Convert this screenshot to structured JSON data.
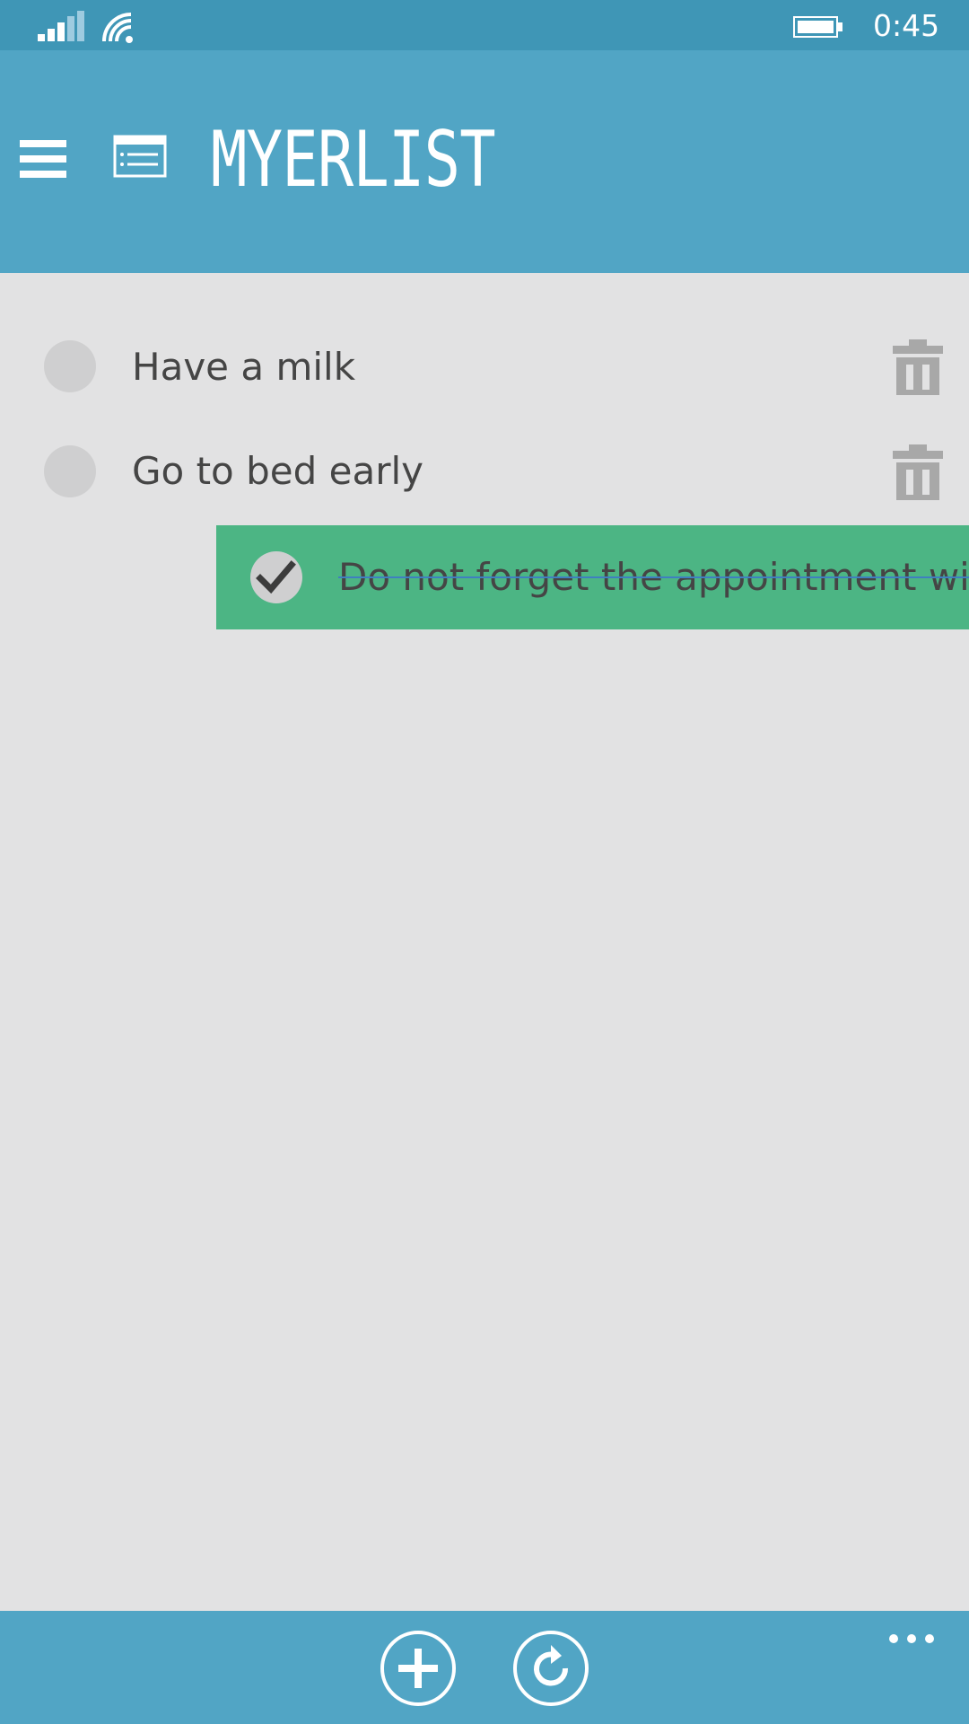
{
  "status_bar": {
    "time": "0:45",
    "icons": [
      "signal-icon",
      "wifi-icon",
      "quiet-hours-moon-icon",
      "battery-icon"
    ]
  },
  "header": {
    "title": "MYERLIST",
    "menu_icon": "hamburger-menu-icon",
    "app_icon": "list-icon"
  },
  "tasks": [
    {
      "text": "Have a milk",
      "completed": false
    },
    {
      "text": "Go to bed early",
      "completed": false
    },
    {
      "text": "Do not forget the appointment with r",
      "completed": true
    }
  ],
  "app_bar": {
    "buttons": [
      "add-icon",
      "sync-icon",
      "more-icon"
    ]
  },
  "colors": {
    "header": "#51a5c5",
    "status_bar": "#3f96b6",
    "background": "#e2e2e3",
    "completed_row": "#4cb584",
    "text": "#454545",
    "trash": "#a8a8a8"
  }
}
